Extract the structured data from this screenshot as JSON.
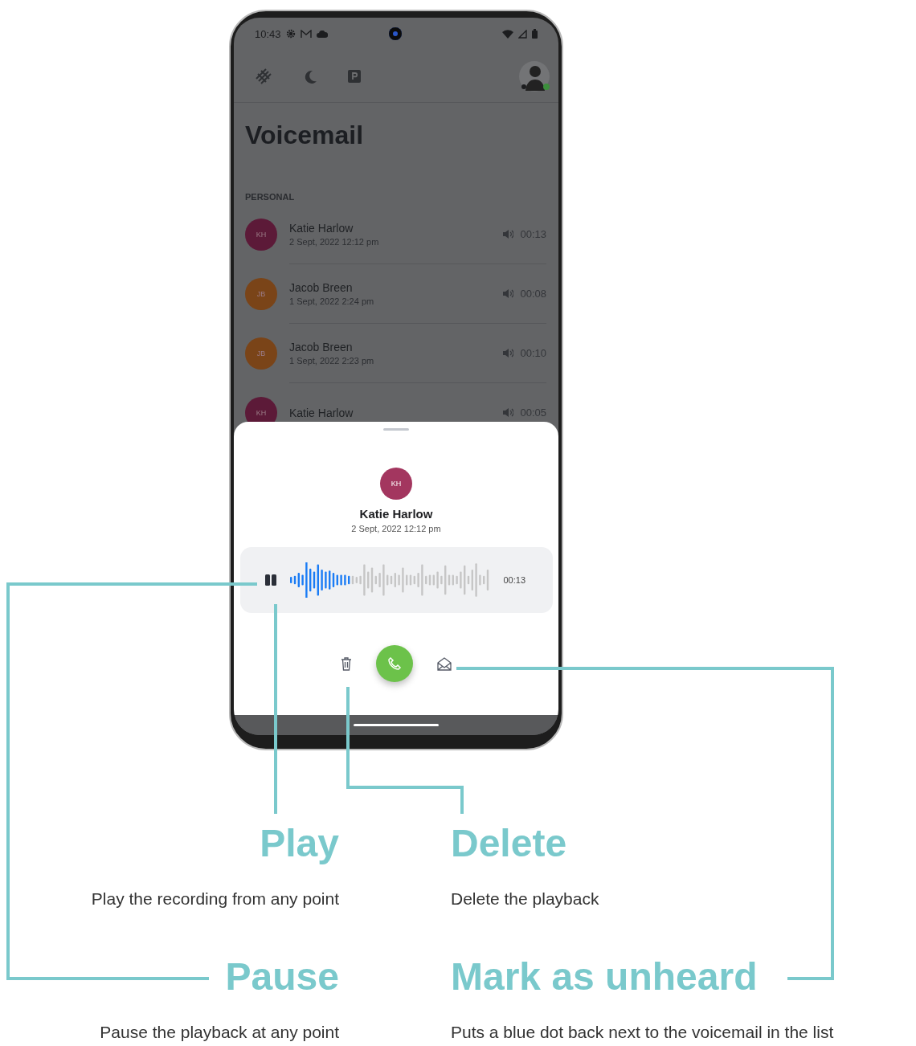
{
  "status_bar": {
    "time": "10:43"
  },
  "title": "Voicemail",
  "section": "PERSONAL",
  "voicemails": [
    {
      "initials": "KH",
      "color": "#5c1a38",
      "name": "Katie Harlow",
      "date": "2 Sept, 2022 12:12 pm",
      "duration": "00:13"
    },
    {
      "initials": "JB",
      "color": "#7a4418",
      "name": "Jacob Breen",
      "date": "1 Sept, 2022 2:24 pm",
      "duration": "00:08"
    },
    {
      "initials": "JB",
      "color": "#7a4418",
      "name": "Jacob Breen",
      "date": "1 Sept, 2022 2:23 pm",
      "duration": "00:10"
    },
    {
      "initials": "KH",
      "color": "#5c1a38",
      "name": "Katie Harlow",
      "duration": "00:05"
    }
  ],
  "player_sheet": {
    "initials": "KH",
    "color": "#a3365f",
    "name": "Katie Harlow",
    "date": "2 Sept, 2022 12:12 pm",
    "playing": true,
    "level": 0.3,
    "elapsed": "00:13"
  },
  "annotations": [
    {
      "title": "Play",
      "description": "Play the recording from any point"
    },
    {
      "title": "Delete",
      "description": "Delete the playback"
    },
    {
      "title": "Pause",
      "description": "Pause the playback at any point"
    },
    {
      "title": "Mark as unheard",
      "description": "Puts a blue dot back next to the voicemail in the list"
    }
  ]
}
